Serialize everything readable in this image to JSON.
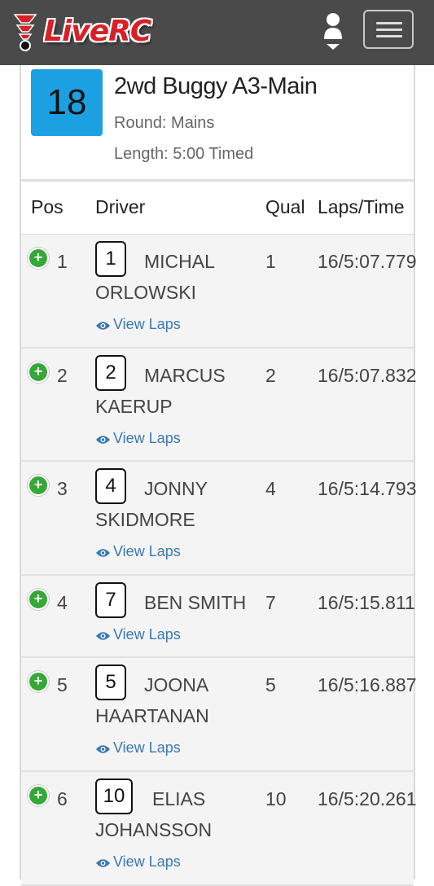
{
  "brand": {
    "name": "LiveRC"
  },
  "race": {
    "number": "18",
    "title": "2wd Buggy A3-Main",
    "round": "Round: Mains",
    "length": "Length: 5:00 Timed"
  },
  "columns": {
    "pos": "Pos",
    "driver": "Driver",
    "qual": "Qual",
    "laps": "Laps/Time"
  },
  "view_laps_label": "View Laps",
  "results": [
    {
      "pos": "1",
      "car": "1",
      "first": "MICHAL",
      "last": "ORLOWSKI",
      "qual": "1",
      "laps": "16/5:07.779"
    },
    {
      "pos": "2",
      "car": "2",
      "first": "MARCUS",
      "last": "KAERUP",
      "qual": "2",
      "laps": "16/5:07.832"
    },
    {
      "pos": "3",
      "car": "4",
      "first": "JONNY",
      "last": "SKIDMORE",
      "qual": "4",
      "laps": "16/5:14.793"
    },
    {
      "pos": "4",
      "car": "7",
      "first": "BEN SMITH",
      "last": "",
      "qual": "7",
      "laps": "16/5:15.811"
    },
    {
      "pos": "5",
      "car": "5",
      "first": "JOONA",
      "last": "HAARTANAN",
      "qual": "5",
      "laps": "16/5:16.887"
    },
    {
      "pos": "6",
      "car": "10",
      "first": "ELIAS",
      "last": "JOHANSSON",
      "qual": "10",
      "laps": "16/5:20.261"
    }
  ],
  "colors": {
    "navbar": "#4a4a4a",
    "race_badge": "#1ba1e2",
    "expand_icon": "#35a837",
    "link": "#3a78b4",
    "logo": "#d82027"
  },
  "icons": {
    "logo": "liverc-logo-icon",
    "user": "user-icon",
    "menu": "hamburger-menu-icon",
    "expand": "plus-circle-icon",
    "view": "eye-icon"
  }
}
